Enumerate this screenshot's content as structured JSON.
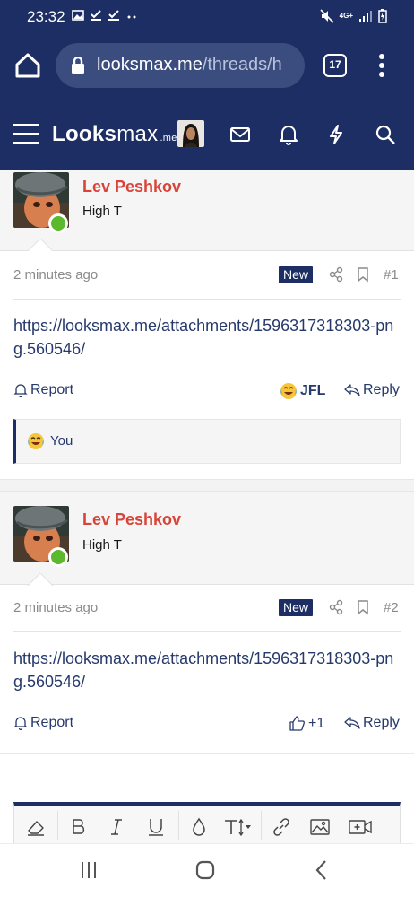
{
  "status_bar": {
    "time": "23:32",
    "network": "4G+"
  },
  "browser": {
    "domain": "looksmax.me",
    "path": "/threads/h",
    "tab_count": "17"
  },
  "site": {
    "logo_main": "Looks",
    "logo_rest": "max",
    "logo_suffix": ".me"
  },
  "posts": [
    {
      "username": "Lev Peshkov",
      "user_title": "High T",
      "time": "2 minutes ago",
      "badge": "New",
      "number": "#1",
      "link": "https://looksmax.me/attachments/1596317318303-png.560546/",
      "report_label": "Report",
      "reaction_label": "JFL",
      "reply_label": "Reply",
      "reactions_summary": "You"
    },
    {
      "username": "Lev Peshkov",
      "user_title": "High T",
      "time": "2 minutes ago",
      "badge": "New",
      "number": "#2",
      "link": "https://looksmax.me/attachments/1596317318303-png.560546/",
      "report_label": "Report",
      "reaction_label": "+1",
      "reply_label": "Reply"
    }
  ],
  "colors": {
    "header_bg": "#1c2e63",
    "username": "#d8443a",
    "link": "#26396b",
    "online": "#5cb82d"
  }
}
